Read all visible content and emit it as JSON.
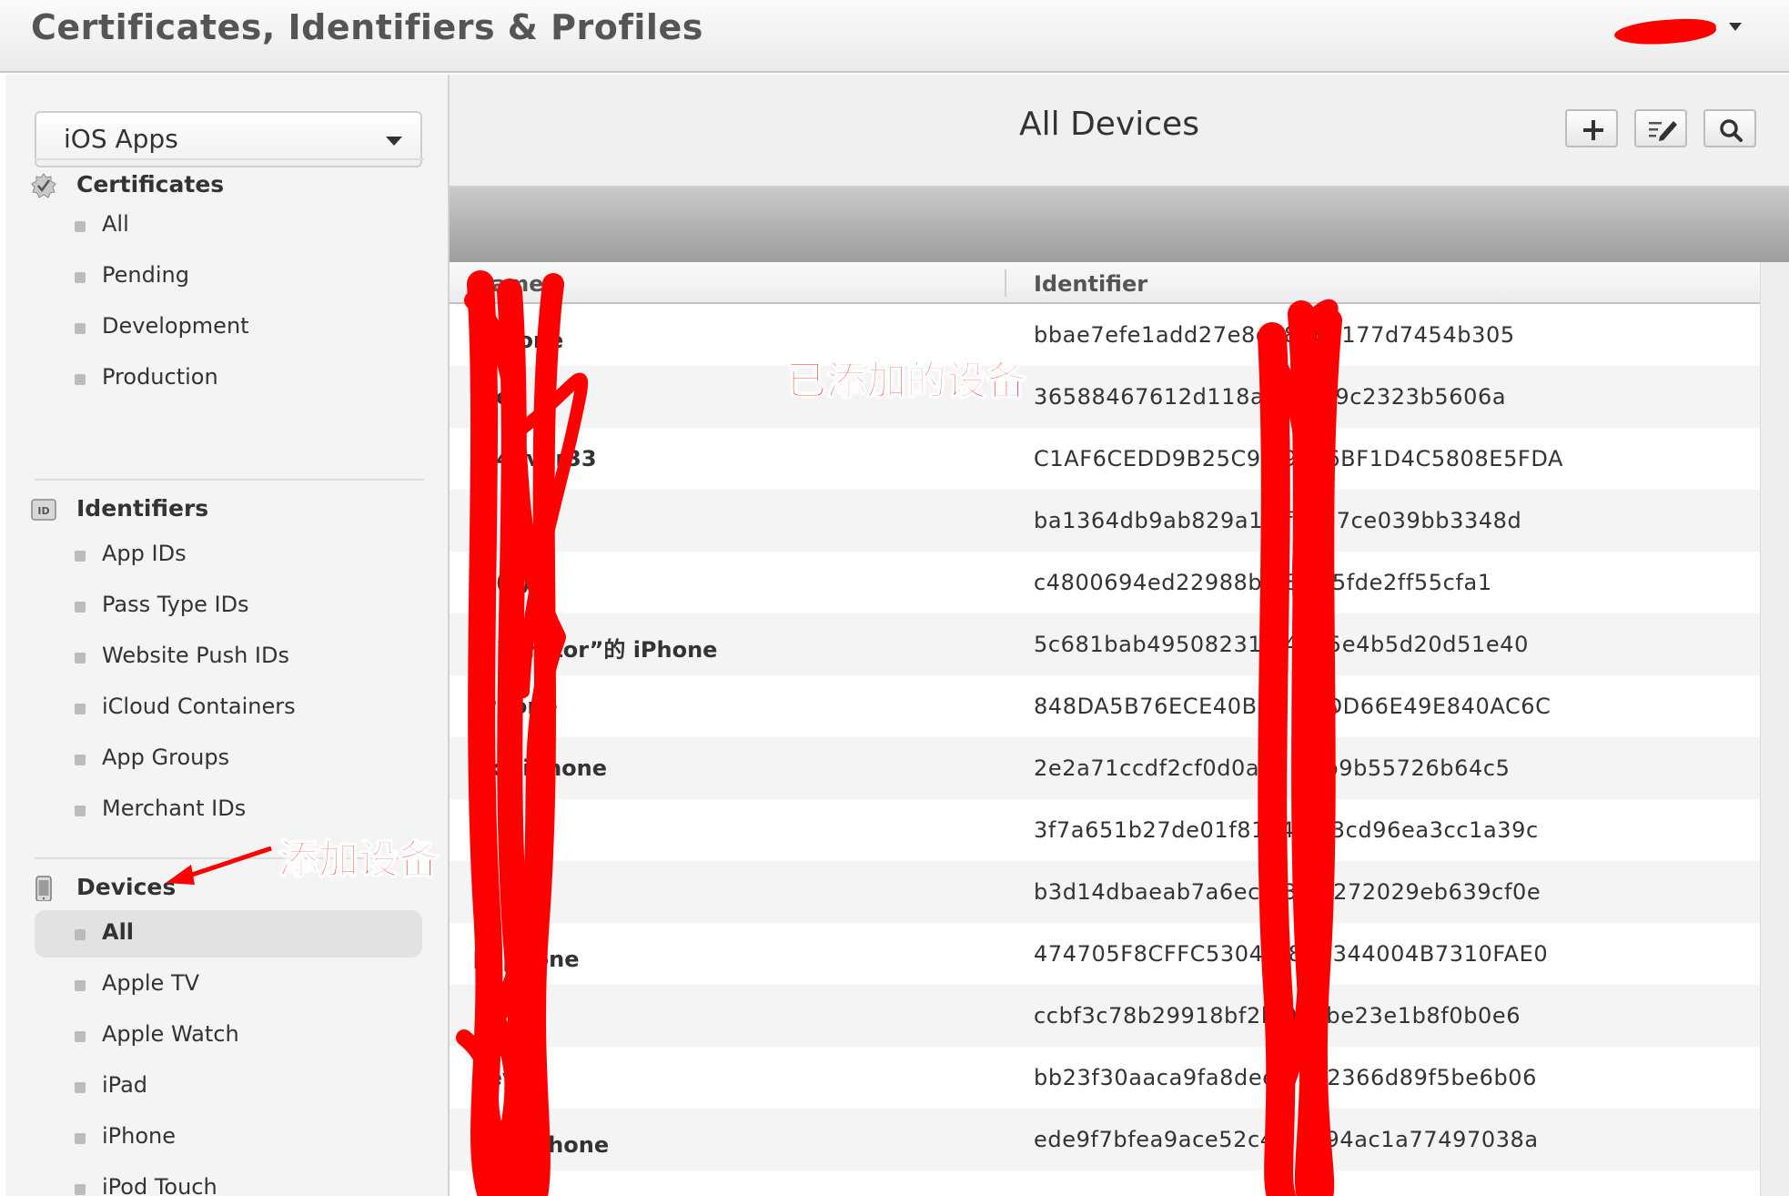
{
  "header": {
    "title": "Certificates, Identifiers & Profiles",
    "account_caret_icon": "caret-down-icon"
  },
  "sidebar": {
    "platform_select": {
      "value": "iOS Apps"
    },
    "sections": {
      "certificates": {
        "label": "Certificates",
        "icon": "certificate-badge-icon",
        "items": [
          "All",
          "Pending",
          "Development",
          "Production"
        ]
      },
      "identifiers": {
        "label": "Identifiers",
        "icon": "id-icon",
        "items": [
          "App IDs",
          "Pass Type IDs",
          "Website Push IDs",
          "iCloud Containers",
          "App Groups",
          "Merchant IDs"
        ]
      },
      "devices": {
        "label": "Devices",
        "icon": "device-icon",
        "active_item": "All",
        "items": [
          "All",
          "Apple TV",
          "Apple Watch",
          "iPad",
          "iPhone",
          "iPod Touch"
        ]
      }
    }
  },
  "main": {
    "title": "All Devices",
    "toolbar": {
      "add_icon": "plus-icon",
      "edit_icon": "edit-icon",
      "search_icon": "search-icon"
    },
    "table": {
      "columns": {
        "name": "Name",
        "identifier": "Identifier"
      },
      "rows": [
        {
          "name": "的 hone",
          "identifier": "bbae7efe1add27e8cf 8568177d7454b305"
        },
        {
          "name": "o e",
          "identifier": "36588467612d118a acdf39c2323b5606a"
        },
        {
          "name": "n 4ever33",
          "identifier": "C1AF6CEDD9B25C94 9E56BF1D4C5808E5FDA"
        },
        {
          "name": "",
          "identifier": "ba1364db9ab829a1d fb377ce039bb3348d"
        },
        {
          "name": "e (2)",
          "identifier": "c4800694ed22988bd 8ccf5fde2ff55cfa1"
        },
        {
          "name": "inistrator”的 iPhone",
          "identifier": "5c681bab495082316 4885e4b5d20d51e40"
        },
        {
          "name": "iPhone",
          "identifier": "848DA5B76ECE40BD9 00DD66E49E840AC6C"
        },
        {
          "name": "sky iPhone",
          "identifier": "2e2a71ccdf2cf0d0a8a 54b9b55726b64c5"
        },
        {
          "name": "",
          "identifier": "3f7a651b27de01f8164 223cd96ea3cc1a39c"
        },
        {
          "name": "",
          "identifier": "b3d14dbaeab7a6ec6f3 6a272029eb639cf0e"
        },
        {
          "name": "的 phone",
          "identifier": "474705F8CFFC5304D 8B6344004B7310FAE0"
        },
        {
          "name": "n",
          "identifier": "ccbf3c78b29918bf2b 0bbbe23e1b8f0b0e6"
        },
        {
          "name": "veyou",
          "identifier": "bb23f30aaca9fa8dee5 332366d89f5be6b06"
        },
        {
          "name": "何 的iPhone",
          "identifier": "ede9f7bfea9ace52c4d 7094ac1a77497038a"
        },
        {
          "name": "",
          "identifier": ""
        }
      ]
    }
  },
  "annotations": {
    "added_devices": "已添加的设备",
    "add_device": "添加设备",
    "color": "#ff0000"
  },
  "colors": {
    "header_bg": "#eeeeee",
    "sidebar_bg": "#f4f4f4",
    "row_alt": "#f4f4f4",
    "redaction": "#ff0000"
  }
}
